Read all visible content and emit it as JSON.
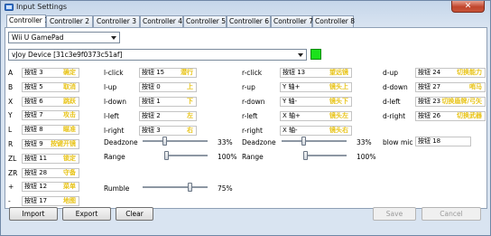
{
  "window": {
    "title": "Input Settings",
    "close": "✕"
  },
  "tabs": [
    {
      "label": "Controller 1",
      "active": true
    },
    {
      "label": "Controller 2"
    },
    {
      "label": "Controller 3"
    },
    {
      "label": "Controller 4"
    },
    {
      "label": "Controller 5"
    },
    {
      "label": "Controller 6"
    },
    {
      "label": "Controller 7"
    },
    {
      "label": "Controller 8"
    }
  ],
  "emulated_controller": "Wii U GamePad",
  "input_device": "vJoy Device [31c3e9f0373c51af]",
  "indicator_color": "#1be21b",
  "buttons_col1": [
    {
      "label": "A",
      "value": "按钮 3",
      "tag": "确定"
    },
    {
      "label": "B",
      "value": "按钮 5",
      "tag": "取消"
    },
    {
      "label": "X",
      "value": "按钮 6",
      "tag": "跳跃"
    },
    {
      "label": "Y",
      "value": "按钮 7",
      "tag": "攻击"
    },
    {
      "label": "L",
      "value": "按钮 8",
      "tag": "瞄准"
    },
    {
      "label": "R",
      "value": "按钮 9",
      "tag": "按键开镜"
    },
    {
      "label": "ZL",
      "value": "按钮 11",
      "tag": "锁定"
    },
    {
      "label": "ZR",
      "value": "按钮 28",
      "tag": "守备"
    },
    {
      "label": "+",
      "value": "按钮 12",
      "tag": "菜单"
    },
    {
      "label": "-",
      "value": "按钮 17",
      "tag": "地图"
    }
  ],
  "lstick": [
    {
      "label": "l-click",
      "value": "按钮 15",
      "tag": "潜行"
    },
    {
      "label": "l-up",
      "value": "按钮 0",
      "tag": "上"
    },
    {
      "label": "l-down",
      "value": "按钮 1",
      "tag": "下"
    },
    {
      "label": "l-left",
      "value": "按钮 2",
      "tag": "左"
    },
    {
      "label": "l-right",
      "value": "按钮 3",
      "tag": "右"
    }
  ],
  "rstick": [
    {
      "label": "r-click",
      "value": "按钮 13",
      "tag": "望远镜"
    },
    {
      "label": "r-up",
      "value": "Y 轴+",
      "tag": "镜头上"
    },
    {
      "label": "r-down",
      "value": "Y 轴-",
      "tag": "镜头下"
    },
    {
      "label": "r-left",
      "value": "X 轴+",
      "tag": "镜头左"
    },
    {
      "label": "r-right",
      "value": "X 轴-",
      "tag": "镜头右"
    }
  ],
  "dpad": [
    {
      "label": "d-up",
      "value": "按钮 24",
      "tag": "切换能力"
    },
    {
      "label": "d-down",
      "value": "按钮 27",
      "tag": "哨马"
    },
    {
      "label": "d-left",
      "value": "按钮 23",
      "tag": "切换盾牌/弓矢"
    },
    {
      "label": "d-right",
      "value": "按钮 26",
      "tag": "切换武器"
    }
  ],
  "blow_mic": {
    "label": "blow mic",
    "value": "按钮 18"
  },
  "left_settings": {
    "deadzone_label": "Deadzone",
    "deadzone": "33%",
    "deadzone_pos": 0.33,
    "range_label": "Range",
    "range": "100%",
    "range_pos": 0.0
  },
  "right_settings": {
    "deadzone_label": "Deadzone",
    "deadzone": "33%",
    "deadzone_pos": 0.33,
    "range_label": "Range",
    "range": "100%",
    "range_pos": 0.0
  },
  "rumble": {
    "label": "Rumble",
    "value": "75%",
    "pos": 0.75
  },
  "footer": {
    "import": "Import",
    "export": "Export",
    "clear": "Clear",
    "save": "Save",
    "cancel": "Cancel"
  }
}
